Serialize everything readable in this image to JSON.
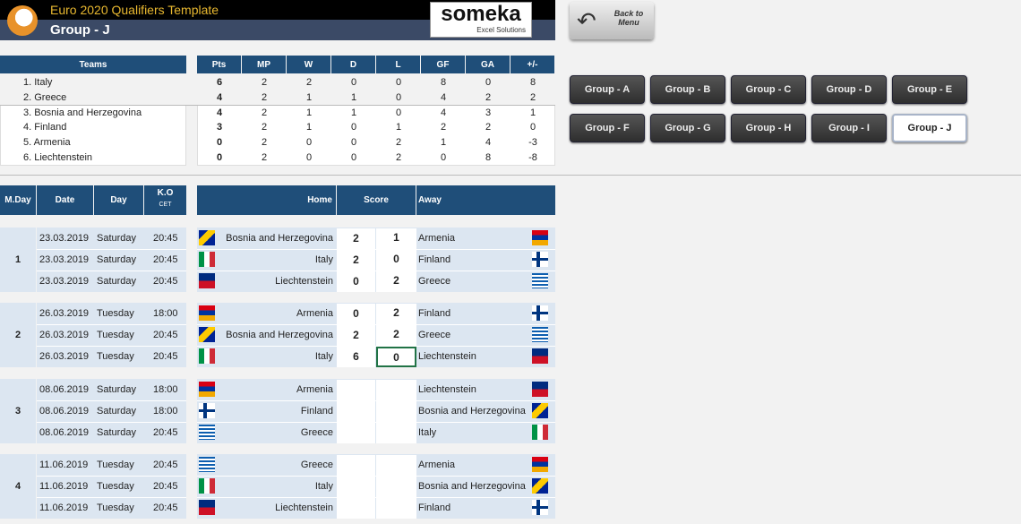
{
  "header": {
    "title": "Euro 2020 Qualifiers Template",
    "group_title": "Group - J",
    "logo_text": "someka",
    "logo_sub": "Excel Solutions",
    "back_button": "Back to Menu"
  },
  "standings": {
    "headers": [
      "Teams",
      "Pts",
      "MP",
      "W",
      "D",
      "L",
      "GF",
      "GA",
      "+/-"
    ],
    "rows": [
      {
        "team": "1. Italy",
        "stats": [
          "6",
          "2",
          "2",
          "0",
          "0",
          "8",
          "0",
          "8"
        ]
      },
      {
        "team": "2. Greece",
        "stats": [
          "4",
          "2",
          "1",
          "1",
          "0",
          "4",
          "2",
          "2"
        ]
      },
      {
        "team": "3. Bosnia and Herzegovina",
        "stats": [
          "4",
          "2",
          "1",
          "1",
          "0",
          "4",
          "3",
          "1"
        ]
      },
      {
        "team": "4. Finland",
        "stats": [
          "3",
          "2",
          "1",
          "0",
          "1",
          "2",
          "2",
          "0"
        ]
      },
      {
        "team": "5. Armenia",
        "stats": [
          "0",
          "2",
          "0",
          "0",
          "2",
          "1",
          "4",
          "-3"
        ]
      },
      {
        "team": "6. Liechtenstein",
        "stats": [
          "0",
          "2",
          "0",
          "0",
          "2",
          "0",
          "8",
          "-8"
        ]
      }
    ]
  },
  "group_buttons": [
    "Group - A",
    "Group - B",
    "Group - C",
    "Group - D",
    "Group - E",
    "Group - F",
    "Group - G",
    "Group - H",
    "Group - I",
    "Group - J"
  ],
  "active_group": "Group - J",
  "fixtures": {
    "headers": {
      "mday": "M.Day",
      "date": "Date",
      "day": "Day",
      "ko": "K.O",
      "ko_sub": "CET",
      "home": "Home",
      "score": "Score",
      "away": "Away"
    },
    "matchdays": [
      {
        "day": "1",
        "matches": [
          {
            "date": "23.03.2019",
            "day": "Saturday",
            "ko": "20:45",
            "home": "Bosnia and Herzegovina",
            "hs": "2",
            "as": "1",
            "away": "Armenia",
            "hf": "bih",
            "af": "arm"
          },
          {
            "date": "23.03.2019",
            "day": "Saturday",
            "ko": "20:45",
            "home": "Italy",
            "hs": "2",
            "as": "0",
            "away": "Finland",
            "hf": "ita",
            "af": "fin"
          },
          {
            "date": "23.03.2019",
            "day": "Saturday",
            "ko": "20:45",
            "home": "Liechtenstein",
            "hs": "0",
            "as": "2",
            "away": "Greece",
            "hf": "lie",
            "af": "gre"
          }
        ]
      },
      {
        "day": "2",
        "matches": [
          {
            "date": "26.03.2019",
            "day": "Tuesday",
            "ko": "18:00",
            "home": "Armenia",
            "hs": "0",
            "as": "2",
            "away": "Finland",
            "hf": "arm",
            "af": "fin"
          },
          {
            "date": "26.03.2019",
            "day": "Tuesday",
            "ko": "20:45",
            "home": "Bosnia and Herzegovina",
            "hs": "2",
            "as": "2",
            "away": "Greece",
            "hf": "bih",
            "af": "gre"
          },
          {
            "date": "26.03.2019",
            "day": "Tuesday",
            "ko": "20:45",
            "home": "Italy",
            "hs": "6",
            "as": "0",
            "away": "Liechtenstein",
            "hf": "ita",
            "af": "lie"
          }
        ]
      },
      {
        "day": "3",
        "matches": [
          {
            "date": "08.06.2019",
            "day": "Saturday",
            "ko": "18:00",
            "home": "Armenia",
            "hs": "",
            "as": "",
            "away": "Liechtenstein",
            "hf": "arm",
            "af": "lie"
          },
          {
            "date": "08.06.2019",
            "day": "Saturday",
            "ko": "18:00",
            "home": "Finland",
            "hs": "",
            "as": "",
            "away": "Bosnia and Herzegovina",
            "hf": "fin",
            "af": "bih"
          },
          {
            "date": "08.06.2019",
            "day": "Saturday",
            "ko": "20:45",
            "home": "Greece",
            "hs": "",
            "as": "",
            "away": "Italy",
            "hf": "gre",
            "af": "ita"
          }
        ]
      },
      {
        "day": "4",
        "matches": [
          {
            "date": "11.06.2019",
            "day": "Tuesday",
            "ko": "20:45",
            "home": "Greece",
            "hs": "",
            "as": "",
            "away": "Armenia",
            "hf": "gre",
            "af": "arm"
          },
          {
            "date": "11.06.2019",
            "day": "Tuesday",
            "ko": "20:45",
            "home": "Italy",
            "hs": "",
            "as": "",
            "away": "Bosnia and Herzegovina",
            "hf": "ita",
            "af": "bih"
          },
          {
            "date": "11.06.2019",
            "day": "Tuesday",
            "ko": "20:45",
            "home": "Liechtenstein",
            "hs": "",
            "as": "",
            "away": "Finland",
            "hf": "lie",
            "af": "fin"
          }
        ]
      }
    ]
  },
  "colors": {
    "header_navy": "#1f4e79",
    "title_gold": "#e8b830",
    "row_blue": "#dce6f1",
    "selected_cell_border": "#217346"
  }
}
